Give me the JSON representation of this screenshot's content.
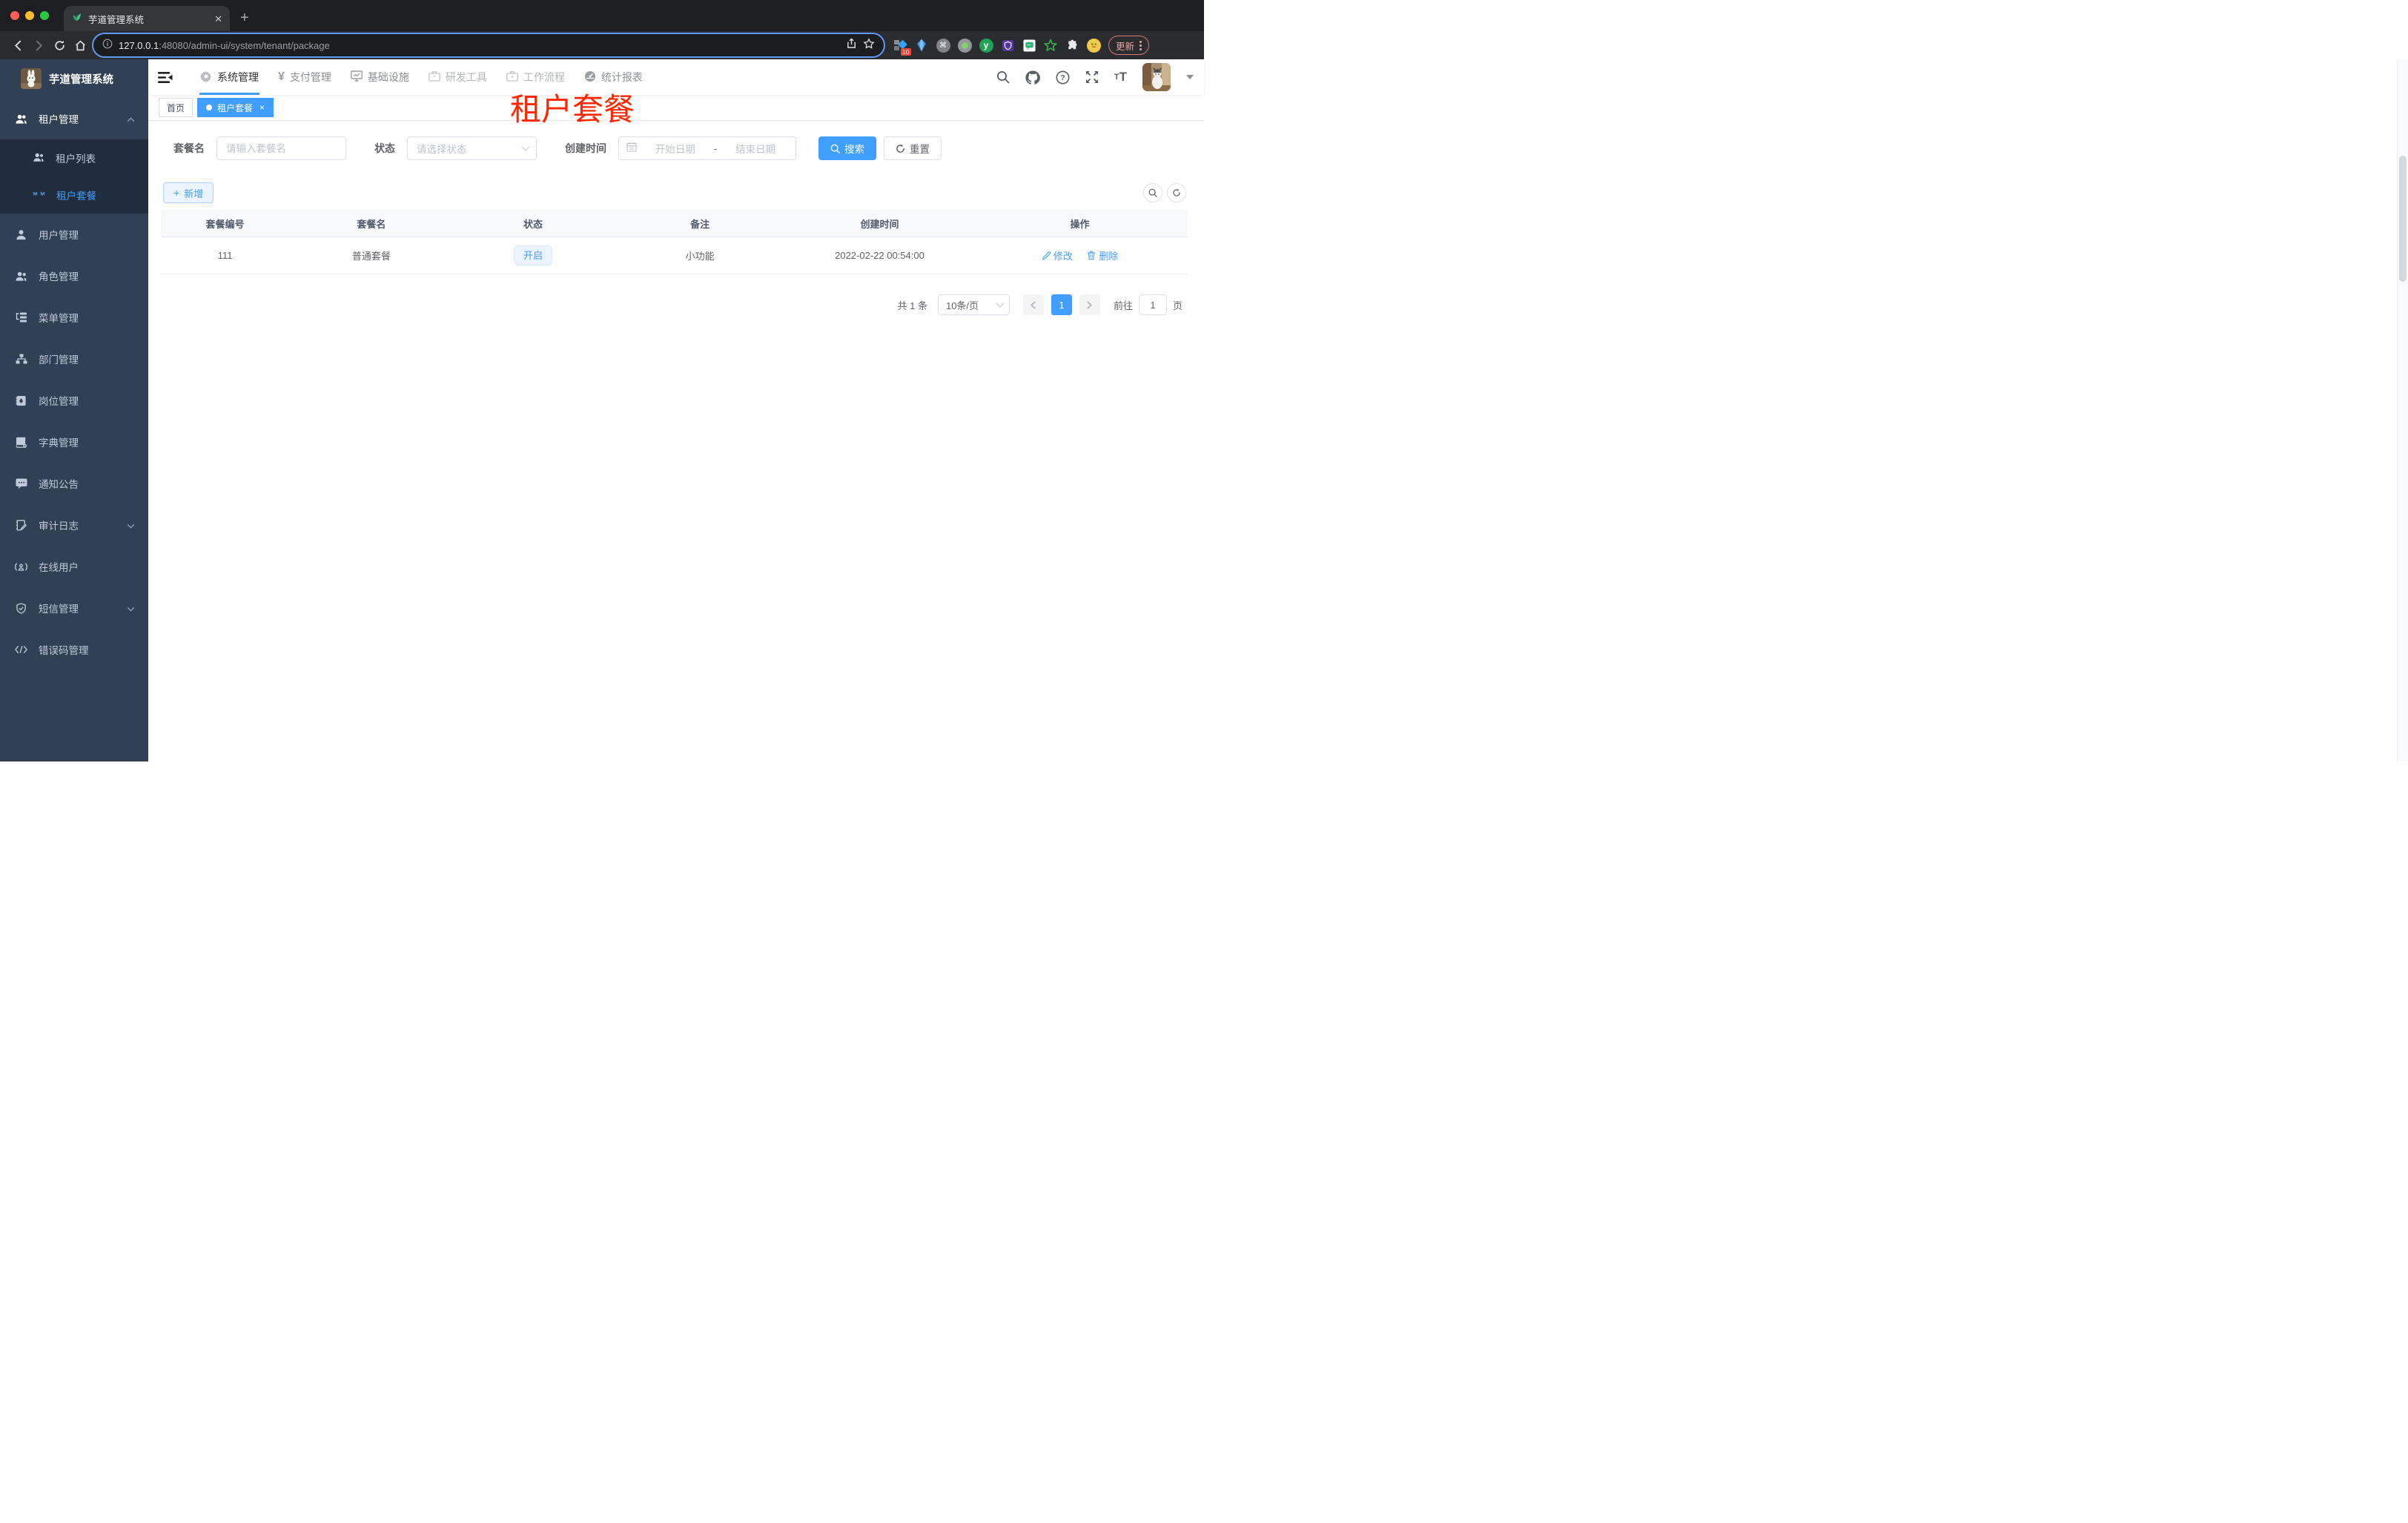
{
  "browser": {
    "tab": {
      "title": "芋道管理系统",
      "close": "✕",
      "new_tab": "+"
    },
    "url": {
      "host": "127.0.0.1",
      "rest": ":48080/admin-ui/system/tenant/package"
    },
    "extension_badge": "10",
    "update_button": "更新"
  },
  "sidebar": {
    "logo_title": "芋道管理系统",
    "menu": [
      {
        "label": "租户管理"
      },
      {
        "label": "租户列表"
      },
      {
        "label": "租户套餐"
      },
      {
        "label": "用户管理"
      },
      {
        "label": "角色管理"
      },
      {
        "label": "菜单管理"
      },
      {
        "label": "部门管理"
      },
      {
        "label": "岗位管理"
      },
      {
        "label": "字典管理"
      },
      {
        "label": "通知公告"
      },
      {
        "label": "审计日志"
      },
      {
        "label": "在线用户"
      },
      {
        "label": "短信管理"
      },
      {
        "label": "错误码管理"
      }
    ]
  },
  "topnav": {
    "items": [
      {
        "label": "系统管理"
      },
      {
        "label": "支付管理"
      },
      {
        "label": "基础设施"
      },
      {
        "label": "研发工具"
      },
      {
        "label": "工作流程"
      },
      {
        "label": "统计报表"
      }
    ],
    "yen": "¥"
  },
  "tags": {
    "home": "首页",
    "active": "租户套餐",
    "close": "×"
  },
  "annotation": "租户套餐",
  "filters": {
    "name_label": "套餐名",
    "name_placeholder": "请输入套餐名",
    "status_label": "状态",
    "status_placeholder": "请选择状态",
    "date_label": "创建时间",
    "date_start": "开始日期",
    "date_sep": "-",
    "date_end": "结束日期",
    "search": "搜索",
    "reset": "重置"
  },
  "toolbar": {
    "add": "新增"
  },
  "table": {
    "headers": [
      "套餐编号",
      "套餐名",
      "状态",
      "备注",
      "创建时间",
      "操作"
    ],
    "rows": [
      {
        "id": "111",
        "name": "普通套餐",
        "status": "开启",
        "remark": "小功能",
        "created": "2022-02-22 00:54:00",
        "edit": "修改",
        "delete": "删除"
      }
    ]
  },
  "pagination": {
    "total": "共 1 条",
    "page_size": "10条/页",
    "current": "1",
    "goto": "前往",
    "goto_value": "1",
    "page_unit": "页"
  },
  "colors": {
    "primary": "#409eff",
    "sidebar_bg": "#304156",
    "submenu_bg": "#1f2d3d",
    "annotation_red": "#ff2600"
  }
}
